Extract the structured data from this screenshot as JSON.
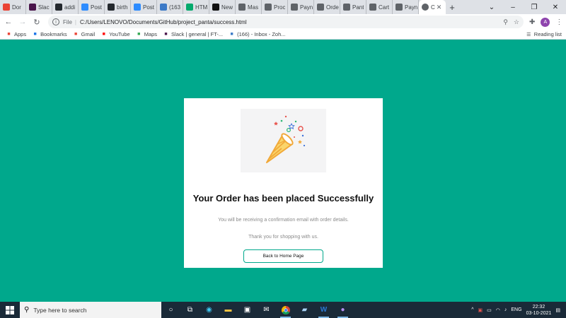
{
  "tabs": [
    {
      "label": "Dor",
      "icon": "gmail-icon",
      "color": "#ea4335"
    },
    {
      "label": "Slac",
      "icon": "slack-icon",
      "color": "#4a154b"
    },
    {
      "label": "addi",
      "icon": "github-icon",
      "color": "#24292e"
    },
    {
      "label": "Post",
      "icon": "zoom-icon",
      "color": "#2d8cff"
    },
    {
      "label": "birth",
      "icon": "github-icon",
      "color": "#24292e"
    },
    {
      "label": "Post",
      "icon": "zoom-icon",
      "color": "#2d8cff"
    },
    {
      "label": "(163",
      "icon": "inbox-icon",
      "color": "#3c7ac7"
    },
    {
      "label": "HTM",
      "icon": "w3-icon",
      "color": "#04aa6d"
    },
    {
      "label": "New",
      "icon": "video-icon",
      "color": "#111111"
    },
    {
      "label": "Mas",
      "icon": "globe-icon",
      "color": "#5f6368"
    },
    {
      "label": "Proc",
      "icon": "globe-icon",
      "color": "#5f6368"
    },
    {
      "label": "Payn",
      "icon": "globe-icon",
      "color": "#5f6368"
    },
    {
      "label": "Orde",
      "icon": "globe-icon",
      "color": "#5f6368"
    },
    {
      "label": "Pant",
      "icon": "globe-icon",
      "color": "#5f6368"
    },
    {
      "label": "Cart",
      "icon": "globe-icon",
      "color": "#5f6368"
    },
    {
      "label": "Payn",
      "icon": "globe-icon",
      "color": "#5f6368"
    }
  ],
  "active_tab": {
    "label": "C",
    "icon": "globe-icon"
  },
  "address": {
    "scheme": "File",
    "url": "C:/Users/LENOVO/Documents/GitHub/project_panta/success.html"
  },
  "avatar_letter": "A",
  "bookmarks": [
    {
      "label": "Apps",
      "icon": "apps-grid-icon",
      "color": "#ea4335"
    },
    {
      "label": "Bookmarks",
      "icon": "star-icon",
      "color": "#1a73e8"
    },
    {
      "label": "Gmail",
      "icon": "gmail-icon",
      "color": "#ea4335"
    },
    {
      "label": "YouTube",
      "icon": "youtube-icon",
      "color": "#ff0000"
    },
    {
      "label": "Maps",
      "icon": "maps-icon",
      "color": "#34a853"
    },
    {
      "label": "Slack | general | FT-...",
      "icon": "slack-icon",
      "color": "#4a154b"
    },
    {
      "label": "(166) - Inbox - Zoh...",
      "icon": "inbox-icon",
      "color": "#3c7ac7"
    }
  ],
  "reading_list": "Reading list",
  "page": {
    "title": "Your Order has been placed Successfully",
    "message_1": "You will be receiving a confirmation email with order details.",
    "message_2": "Thank you for shopping with us.",
    "button": "Back to Home Page",
    "accent": "#00a88c"
  },
  "taskbar": {
    "search_placeholder": "Type here to search",
    "language": "ENG",
    "time": "22:32",
    "date": "03-10-2021"
  }
}
